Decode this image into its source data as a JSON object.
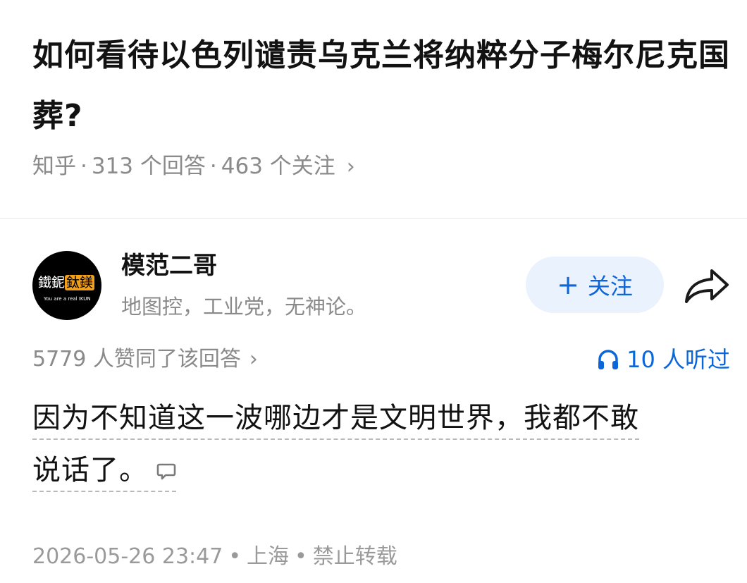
{
  "question": {
    "title": "如何看待以色列谴责乌克兰将纳粹分子梅尔尼克国葬?",
    "source": "知乎",
    "answers_count": "313 个回答",
    "followers_count": "463 个关注",
    "separator": "·",
    "chevron": "›"
  },
  "author": {
    "avatar_main_text_a": "鐵鈮",
    "avatar_main_text_b": "鈦鎂",
    "avatar_sub_text": "You are a real IKUN",
    "name": "模范二哥",
    "bio": "地图控，工业党，无神论。",
    "follow_label": "关注",
    "follow_plus": "+",
    "share_icon": "share-icon"
  },
  "stats": {
    "likes": "5779 人赞同了该回答",
    "chevron": "›",
    "listened": "10 人听过",
    "headphone_icon": "headphone-icon",
    "accent_color": "#0a66d9"
  },
  "answer": {
    "line1": "因为不知道这一波哪边才是文明世界，我都不敢",
    "line2": "说话了。",
    "comment_icon": "comment-icon"
  },
  "footer": {
    "datetime": "2026-05-26 23:47",
    "location": "上海",
    "copyright": "禁止转载",
    "separator": "•"
  }
}
